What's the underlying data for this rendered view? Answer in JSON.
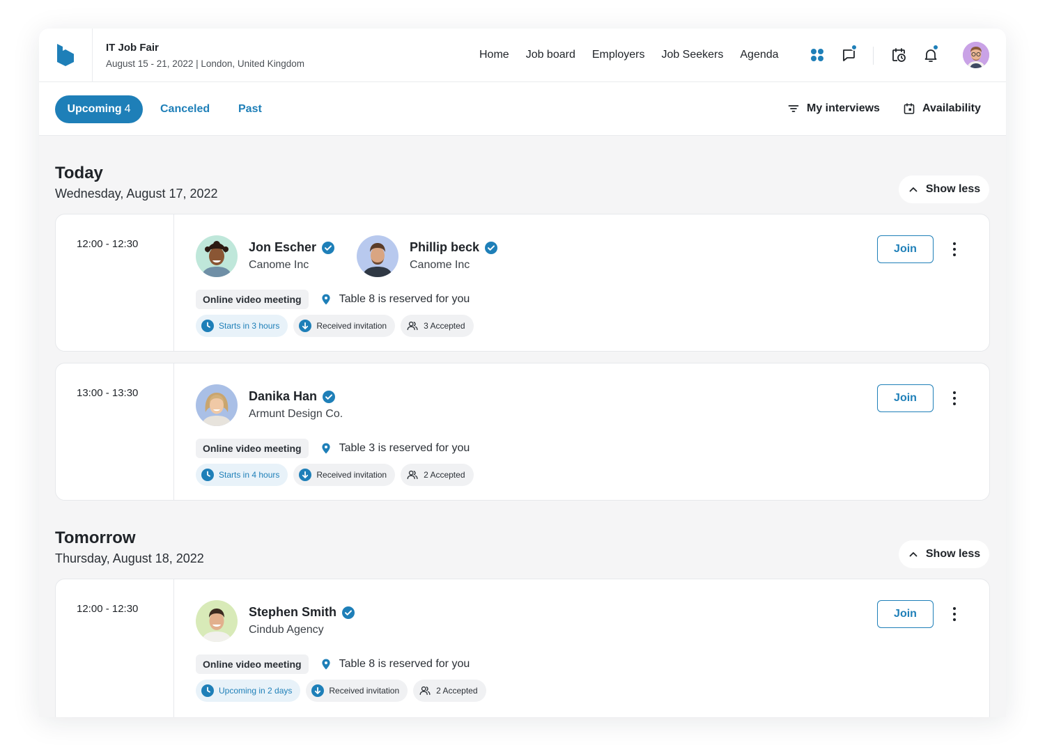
{
  "header": {
    "event_title": "IT Job Fair",
    "event_dates": "August 15 - 21, 2022",
    "event_location": "London, United Kingdom",
    "nav": [
      "Home",
      "Job board",
      "Employers",
      "Job Seekers",
      "Agenda"
    ],
    "icons": [
      "apps-grid-icon",
      "chat-icon",
      "calendar-clock-icon",
      "bell-icon"
    ]
  },
  "subbar": {
    "tabs": {
      "upcoming": "Upcoming",
      "upcoming_count": "4",
      "canceled": "Canceled",
      "past": "Past"
    },
    "my_interviews": "My interviews",
    "availability": "Availability"
  },
  "sections": [
    {
      "title": "Today",
      "date": "Wednesday, August 17, 2022",
      "show_less": "Show less",
      "cards": [
        {
          "time": "12:00 - 12:30",
          "people": [
            {
              "name": "Jon Escher",
              "company": "Canome Inc"
            },
            {
              "name": "Phillip beck",
              "company": "Canome Inc"
            }
          ],
          "meeting_type": "Online video meeting",
          "table": "Table 8 is reserved for you",
          "starts": "Starts in 3 hours",
          "invitation": "Received invitation",
          "accepted": "3 Accepted",
          "join": "Join"
        },
        {
          "time": "13:00 - 13:30",
          "people": [
            {
              "name": "Danika Han",
              "company": "Armunt Design Co."
            }
          ],
          "meeting_type": "Online video meeting",
          "table": "Table 3 is reserved for you",
          "starts": "Starts in 4 hours",
          "invitation": "Received invitation",
          "accepted": "2 Accepted",
          "join": "Join"
        }
      ]
    },
    {
      "title": "Tomorrow",
      "date": "Thursday, August 18, 2022",
      "show_less": "Show less",
      "cards": [
        {
          "time": "12:00 - 12:30",
          "people": [
            {
              "name": "Stephen Smith",
              "company": "Cindub Agency"
            }
          ],
          "meeting_type": "Online video meeting",
          "table": "Table 8 is reserved for you",
          "starts": "Upcoming in 2 days",
          "invitation": "Received invitation",
          "accepted": "2 Accepted",
          "join": "Join"
        }
      ]
    }
  ],
  "colors": {
    "accent": "#1e7fb8",
    "background": "#f5f5f6",
    "card": "#ffffff"
  }
}
